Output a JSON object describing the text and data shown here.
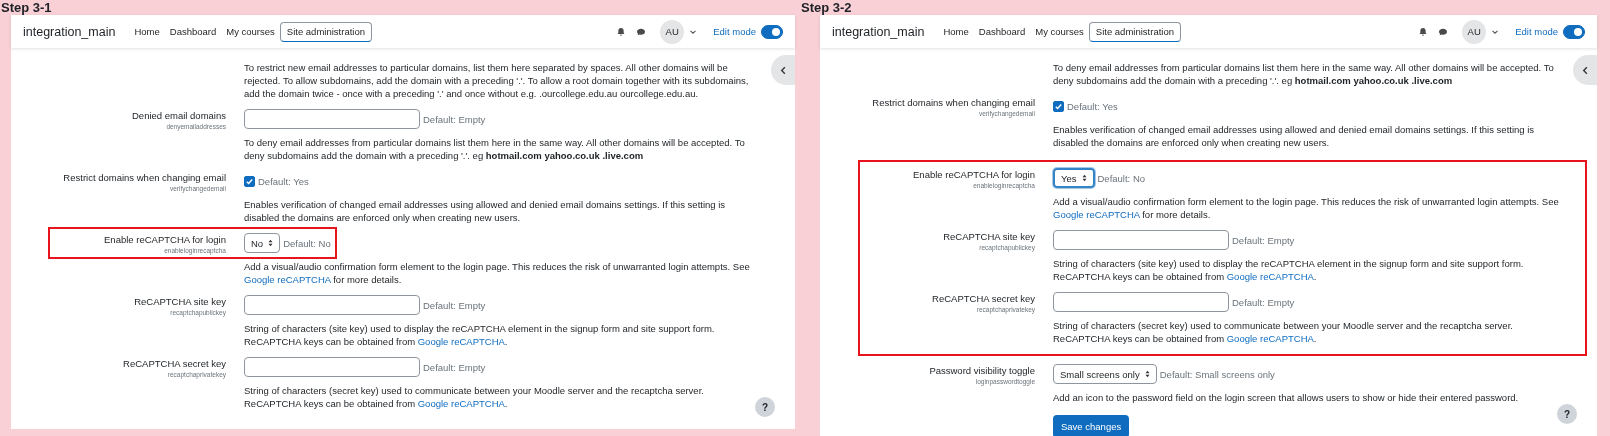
{
  "panels": [
    {
      "step": "Step 3-1",
      "site_name": "integration_main",
      "nav": [
        {
          "label": "Home",
          "selected": false
        },
        {
          "label": "Dashboard",
          "selected": false
        },
        {
          "label": "My courses",
          "selected": false
        },
        {
          "label": "Site administration",
          "selected": true
        }
      ],
      "avatar": "AU",
      "edit_mode": {
        "label": "Edit mode",
        "on": true
      },
      "help": "?",
      "sections": [
        {
          "highlighted": false,
          "settings": [
            {
              "kind": "note",
              "description": [
                {
                  "kind": "text",
                  "text": "To restrict new email addresses to particular domains, list them here separated by spaces. All other domains will be rejected. To allow subdomains, add the domain with a preceding '.'. To allow a root domain together with its subdomains, add the domain twice - once with a preceding '.' and once without e.g. .ourcollege.edu.au ourcollege.edu.au."
                }
              ]
            },
            {
              "kind": "text",
              "outline": false,
              "label": "Denied email domains",
              "key": "denyemailaddresses",
              "default": "Default: Empty",
              "description": [
                {
                  "kind": "text",
                  "text": "To deny email addresses from particular domains list them here in the same way. All other domains will be accepted. To deny subdomains add the domain with a preceding '.'. eg **hotmail.com yahoo.co.uk .live.com**"
                }
              ]
            },
            {
              "kind": "checkbox",
              "outline": false,
              "label": "Restrict domains when changing email",
              "key": "verifychangedemail",
              "checked": true,
              "default": "Default: Yes",
              "description": [
                {
                  "kind": "text",
                  "text": "Enables verification of changed email addresses using allowed and denied email domains settings. If this setting is disabled the domains are enforced only when creating new users."
                }
              ]
            },
            {
              "kind": "select",
              "outline": true,
              "label": "Enable reCAPTCHA for login",
              "key": "enableloginrecaptcha",
              "value": "No",
              "focused": false,
              "default": "Default: No",
              "description": [
                {
                  "kind": "text",
                  "text": "Add a visual/audio confirmation form element to the login page. This reduces the risk of unwarranted login attempts. See "
                },
                {
                  "kind": "link",
                  "text": "Google reCAPTCHA"
                },
                {
                  "kind": "text",
                  "text": " for more details."
                }
              ]
            },
            {
              "kind": "text",
              "outline": false,
              "label": "ReCAPTCHA site key",
              "key": "recaptchapublickey",
              "default": "Default: Empty",
              "description": [
                {
                  "kind": "text",
                  "text": "String of characters (site key) used to display the reCAPTCHA element in the signup form and site support form. ReCAPTCHA keys can be obtained from "
                },
                {
                  "kind": "link",
                  "text": "Google reCAPTCHA"
                },
                {
                  "kind": "text",
                  "text": "."
                }
              ]
            },
            {
              "kind": "text",
              "outline": false,
              "label": "ReCAPTCHA secret key",
              "key": "recaptchaprivatekey",
              "default": "Default: Empty",
              "description": [
                {
                  "kind": "text",
                  "text": "String of characters (secret key) used to communicate between your Moodle server and the recaptcha server. ReCAPTCHA keys can be obtained from "
                },
                {
                  "kind": "link",
                  "text": "Google reCAPTCHA"
                },
                {
                  "kind": "text",
                  "text": "."
                }
              ]
            }
          ]
        }
      ]
    },
    {
      "step": "Step 3-2",
      "site_name": "integration_main",
      "nav": [
        {
          "label": "Home",
          "selected": false
        },
        {
          "label": "Dashboard",
          "selected": false
        },
        {
          "label": "My courses",
          "selected": false
        },
        {
          "label": "Site administration",
          "selected": true
        }
      ],
      "avatar": "AU",
      "edit_mode": {
        "label": "Edit mode",
        "on": true
      },
      "help": "?",
      "save_button": "Save changes",
      "sections": [
        {
          "highlighted": false,
          "settings": [
            {
              "kind": "note",
              "description": [
                {
                  "kind": "text",
                  "text": "To deny email addresses from particular domains list them here in the same way. All other domains will be accepted. To deny subdomains add the domain with a preceding '.'. eg **hotmail.com yahoo.co.uk .live.com**"
                }
              ]
            },
            {
              "kind": "checkbox",
              "outline": false,
              "label": "Restrict domains when changing email",
              "key": "verifychangedemail",
              "checked": true,
              "default": "Default: Yes",
              "description": [
                {
                  "kind": "text",
                  "text": "Enables verification of changed email addresses using allowed and denied email domains settings. If this setting is disabled the domains are enforced only when creating new users."
                }
              ]
            }
          ]
        },
        {
          "highlighted": true,
          "settings": [
            {
              "kind": "select",
              "outline": false,
              "label": "Enable reCAPTCHA for login",
              "key": "enableloginrecaptcha",
              "value": "Yes",
              "focused": true,
              "default": "Default: No",
              "description": [
                {
                  "kind": "text",
                  "text": "Add a visual/audio confirmation form element to the login page. This reduces the risk of unwarranted login attempts. See "
                },
                {
                  "kind": "link",
                  "text": "Google reCAPTCHA"
                },
                {
                  "kind": "text",
                  "text": " for more details."
                }
              ]
            },
            {
              "kind": "text",
              "outline": false,
              "label": "ReCAPTCHA site key",
              "key": "recaptchapublickey",
              "default": "Default: Empty",
              "description": [
                {
                  "kind": "text",
                  "text": "String of characters (site key) used to display the reCAPTCHA element in the signup form and site support form. ReCAPTCHA keys can be obtained from "
                },
                {
                  "kind": "link",
                  "text": "Google reCAPTCHA"
                },
                {
                  "kind": "text",
                  "text": "."
                }
              ]
            },
            {
              "kind": "text",
              "outline": false,
              "label": "ReCAPTCHA secret key",
              "key": "recaptchaprivatekey",
              "default": "Default: Empty",
              "description": [
                {
                  "kind": "text",
                  "text": "String of characters (secret key) used to communicate between your Moodle server and the recaptcha server. ReCAPTCHA keys can be obtained from "
                },
                {
                  "kind": "link",
                  "text": "Google reCAPTCHA"
                },
                {
                  "kind": "text",
                  "text": "."
                }
              ]
            }
          ]
        },
        {
          "highlighted": false,
          "settings": [
            {
              "kind": "select",
              "outline": false,
              "label": "Password visibility toggle",
              "key": "loginpasswordtoggle",
              "value": "Small screens only",
              "focused": false,
              "default": "Default: Small screens only",
              "description": [
                {
                  "kind": "text",
                  "text": "Add an icon to the password field on the login screen that allows users to show or hide their entered password."
                }
              ]
            }
          ]
        }
      ]
    }
  ]
}
